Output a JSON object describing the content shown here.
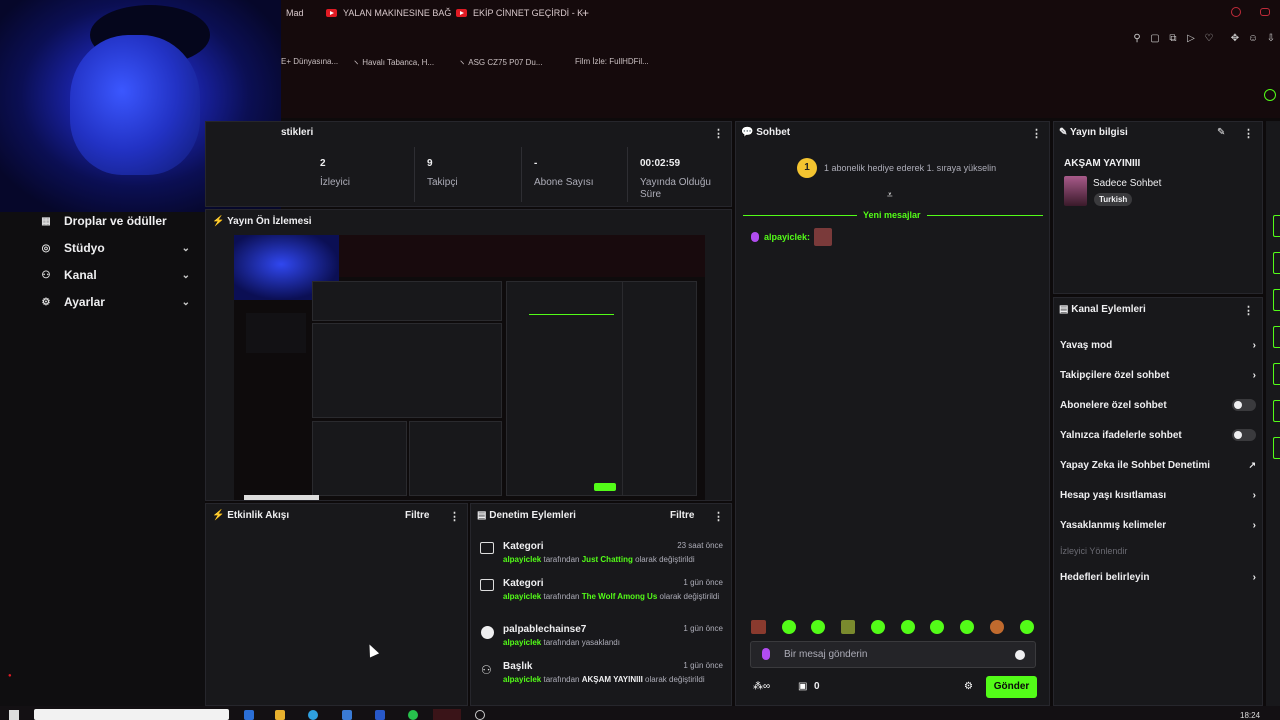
{
  "browser": {
    "tabs": [
      "Mad",
      "YALAN MAKINESINE BAĞ",
      "EKİP CİNNET GEÇİRDİ - K"
    ],
    "new_tab": "+",
    "bookmarks": [
      "E+ Dünyasına...",
      "Havalı Tabanca, H...",
      "ASG CZ75 P07 Du...",
      "Film İzle: FullHDFil..."
    ]
  },
  "sidebar": {
    "items": [
      {
        "label": "Droplar ve ödüller",
        "icon": "gift-icon"
      },
      {
        "label": "Stüdyo",
        "icon": "studio-icon"
      },
      {
        "label": "Kanal",
        "icon": "users-icon"
      },
      {
        "label": "Ayarlar",
        "icon": "gear-icon"
      }
    ]
  },
  "stats": {
    "title": "stikleri",
    "items": [
      {
        "value": "2",
        "label": "İzleyici"
      },
      {
        "value": "9",
        "label": "Takipçi"
      },
      {
        "value": "-",
        "label": "Abone Sayısı"
      },
      {
        "value": "00:02:59",
        "label": "Yayında Olduğu Süre"
      }
    ]
  },
  "preview": {
    "title": "Yayın Ön İzlemesi"
  },
  "activity": {
    "title": "Etkinlik Akışı",
    "filter": "Filtre"
  },
  "modlog": {
    "title": "Denetim Eylemleri",
    "filter": "Filtre",
    "items": [
      {
        "title": "Kategori",
        "when": "23 saat önce",
        "user": "alpayiclek",
        "mid": " tarafından ",
        "val": "Just Chatting",
        "tail": " olarak değiştirildi",
        "icon": "category-icon"
      },
      {
        "title": "Kategori",
        "when": "1 gün önce",
        "user": "alpayiclek",
        "mid": " tarafından ",
        "val": "The Wolf Among Us",
        "tail": " olarak değiştirildi",
        "icon": "category-icon"
      },
      {
        "title": "palpablechainse7",
        "when": "1 gün önce",
        "user": "alpayiclek",
        "mid": " tarafından yasaklandı",
        "val": "",
        "tail": "",
        "icon": "ban-icon"
      },
      {
        "title": "Başlık",
        "when": "1 gün önce",
        "user": "alpayiclek",
        "mid": " tarafından ",
        "val": "AKŞAM YAYINIII",
        "tail": " olarak değiştirildi",
        "icon": "title-icon"
      }
    ]
  },
  "chat": {
    "title": "Sohbet",
    "gift_count": "1",
    "gift_text": "1 abonelik hediye ederek 1. sıraya yükselin",
    "new_messages": "Yeni mesajlar",
    "message_user": "alpayiclek:",
    "input_placeholder": "Bir mesaj gönderin",
    "count": "0",
    "send": "Gönder"
  },
  "stream_info": {
    "title": "Yayın bilgisi",
    "stream_title": "AKŞAM YAYINIII",
    "category": "Sadece Sohbet",
    "tag": "Turkish"
  },
  "channel_actions": {
    "title": "Kanal Eylemleri",
    "items": [
      {
        "label": "Yavaş mod",
        "control": "chevron"
      },
      {
        "label": "Takipçilere özel sohbet",
        "control": "chevron"
      },
      {
        "label": "Abonelere özel sohbet",
        "control": "toggle"
      },
      {
        "label": "Yalnızca ifadelerle sohbet",
        "control": "toggle"
      },
      {
        "label": "Yapay Zeka ile Sohbet Denetimi",
        "control": "external"
      },
      {
        "label": "Hesap yaşı kısıtlaması",
        "control": "chevron"
      },
      {
        "label": "Yasaklanmış kelimeler",
        "control": "chevron"
      },
      {
        "label": "İzleyici Yönlendir",
        "control": "none"
      },
      {
        "label": "Hedefleri belirleyin",
        "control": "chevron"
      }
    ]
  },
  "taskbar": {
    "time": "18:24"
  },
  "colors": {
    "accent": "#53fc18",
    "panel": "#18181b",
    "background": "#0d0a0b"
  }
}
